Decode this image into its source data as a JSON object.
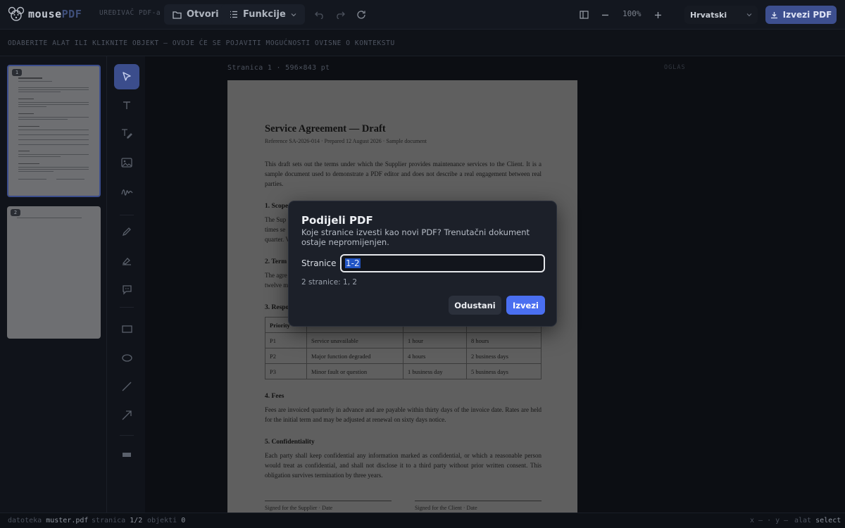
{
  "app": {
    "logo_text": "mouse",
    "logo_accent": "PDF",
    "subtitle": "UREĐIVAČ PDF-a"
  },
  "toolbar": {
    "open_label": "Otvori",
    "features_label": "Funkcije",
    "zoom": "100%",
    "language": "Hrvatski",
    "export_label": "Izvezi PDF"
  },
  "context_hint": "ODABERITE ALAT ILI KLIKNITE OBJEKT — OVDJE ĆE SE POJAVITI MOGUĆNOSTI OVISNE O KONTEKSTU",
  "thumbnails": [
    {
      "number": "1",
      "selected": true
    },
    {
      "number": "2",
      "selected": false
    }
  ],
  "canvas": {
    "page_label": "Stranica 1 · 596×843 pt",
    "ad_label": "OGLAS"
  },
  "document": {
    "title": "Service Agreement — Draft",
    "reference": "Reference SA-2026-014 · Prepared 12 August 2026 · Sample document",
    "intro": "This draft sets out the terms under which the Supplier provides maintenance services to the Client. It is a sample document used to demonstrate a PDF editor and does not describe a real engagement between real parties.",
    "s1_heading": "1. Scope",
    "s1_text": "The Supplier ... times se... quarter. V...",
    "s2_heading": "2. Term",
    "s2_text": "The agre... twelve m...",
    "s3_heading": "3. Response times",
    "table": {
      "headers": [
        "Priority",
        "",
        "",
        ""
      ],
      "rows": [
        [
          "P1",
          "Service unavailable",
          "1 hour",
          "8 hours"
        ],
        [
          "P2",
          "Major function degraded",
          "4 hours",
          "2 business days"
        ],
        [
          "P3",
          "Minor fault or question",
          "1 business day",
          "5 business days"
        ]
      ]
    },
    "s4_heading": "4. Fees",
    "s4_text": "Fees are invoiced quarterly in advance and are payable within thirty days of the invoice date. Rates are held for the initial term and may be adjusted at renewal on sixty days notice.",
    "s5_heading": "5. Confidentiality",
    "s5_text": "Each party shall keep confidential any information marked as confidential, or which a reasonable person would treat as confidential, and shall not disclose it to a third party without prior written consent. This obligation survives termination by three years.",
    "sig_supplier": "Signed for the Supplier · Date",
    "sig_client": "Signed for the Client · Date"
  },
  "modal": {
    "title": "Podijeli PDF",
    "description": "Koje stranice izvesti kao novi PDF? Trenutačni dokument ostaje nepromijenjen.",
    "pages_label": "Stranice",
    "pages_value": "1-2",
    "pages_info": "2 stranice: 1, 2",
    "cancel_label": "Odustani",
    "confirm_label": "Izvezi"
  },
  "statusbar": {
    "file_label": "datoteka",
    "file_value": "muster.pdf",
    "page_label": "stranica",
    "page_value": "1/2",
    "objects_label": "objekti",
    "objects_value": "0",
    "coords": "x — · y —",
    "tool_label": "alat",
    "tool_value": "select"
  }
}
